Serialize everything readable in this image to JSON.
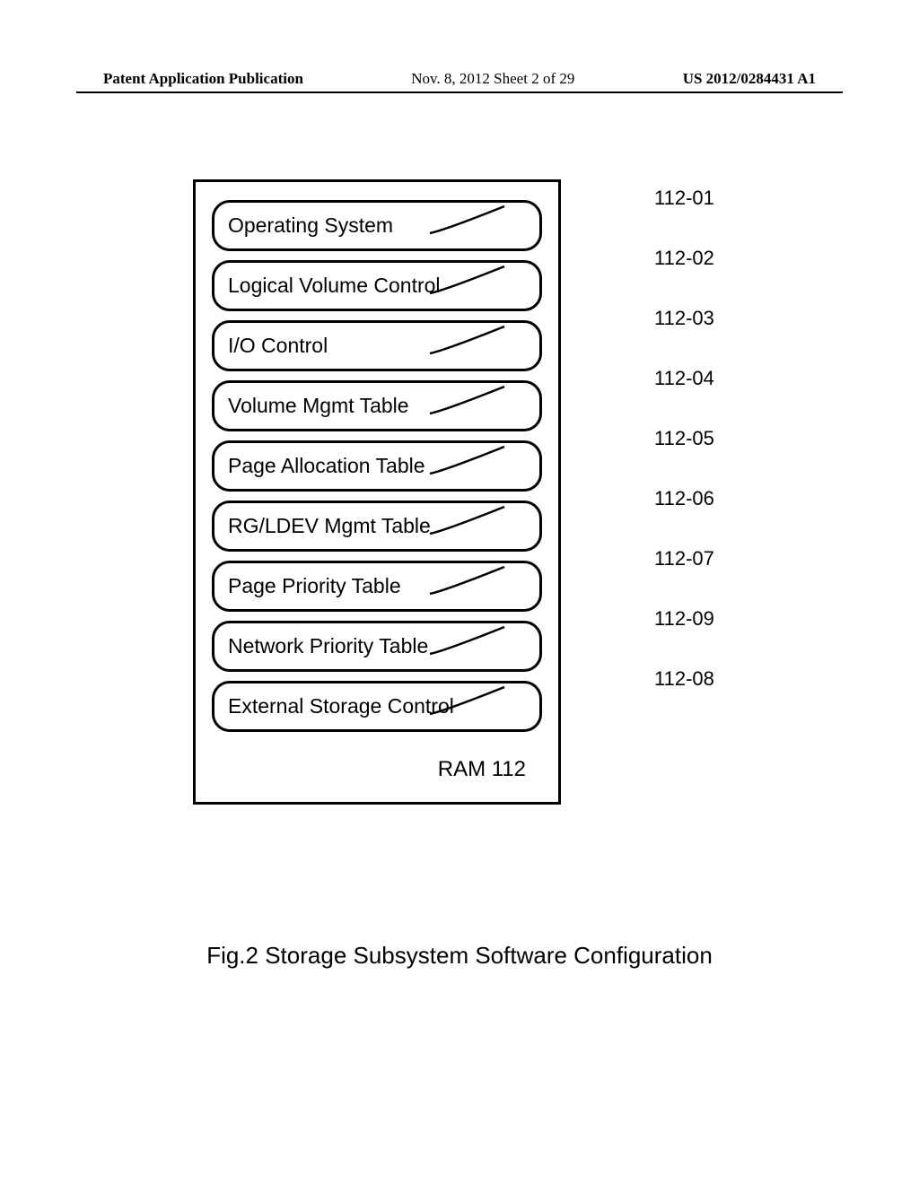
{
  "header": {
    "left": "Patent Application Publication",
    "mid": "Nov. 8, 2012  Sheet 2 of 29",
    "right": "US 2012/0284431 A1"
  },
  "ram_label": "RAM 112",
  "caption": "Fig.2 Storage Subsystem Software Configuration",
  "modules": [
    {
      "label": "Operating System",
      "ref": "112-01"
    },
    {
      "label": "Logical Volume Control",
      "ref": "112-02"
    },
    {
      "label": "I/O Control",
      "ref": "112-03"
    },
    {
      "label": "Volume Mgmt Table",
      "ref": "112-04"
    },
    {
      "label": "Page Allocation Table",
      "ref": "112-05"
    },
    {
      "label": "RG/LDEV Mgmt Table",
      "ref": "112-06"
    },
    {
      "label": "Page Priority Table",
      "ref": "112-07"
    },
    {
      "label": "Network Priority Table",
      "ref": "112-09"
    },
    {
      "label": "External Storage Control",
      "ref": "112-08"
    }
  ]
}
